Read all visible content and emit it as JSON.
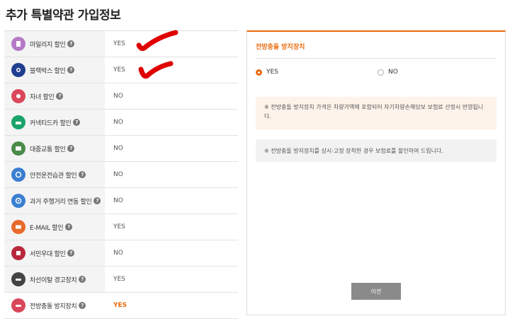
{
  "page_title": "추가 특별약관 가입정보",
  "items": [
    {
      "label": "마일리지 할인",
      "value": "YES",
      "icon": "mileage-icon",
      "color": "#b57ac6"
    },
    {
      "label": "블랙박스 할인",
      "value": "YES",
      "icon": "blackbox-icon",
      "color": "#1f3f8f"
    },
    {
      "label": "자녀 할인",
      "value": "NO",
      "icon": "child-icon",
      "color": "#d9485a"
    },
    {
      "label": "커넥티드카 할인",
      "value": "NO",
      "icon": "connected-car-icon",
      "color": "#1aa36a"
    },
    {
      "label": "대중교통 할인",
      "value": "NO",
      "icon": "bus-icon",
      "color": "#4a8c4a"
    },
    {
      "label": "안전운전습관 할인",
      "value": "NO",
      "icon": "safe-driving-icon",
      "color": "#3b7fd1"
    },
    {
      "label": "과거 주행거리 연동 할인",
      "value": "NO",
      "icon": "odometer-icon",
      "color": "#3b7fd1"
    },
    {
      "label": "E-MAIL 할인",
      "value": "YES",
      "icon": "email-icon",
      "color": "#e86a2c"
    },
    {
      "label": "서민우대 할인",
      "value": "NO",
      "icon": "low-income-icon",
      "color": "#b8283c"
    },
    {
      "label": "차선이탈 경고장치",
      "value": "YES",
      "icon": "lane-departure-icon",
      "color": "#444"
    },
    {
      "label": "전방충돌 방지장치",
      "value": "YES",
      "icon": "collision-icon",
      "color": "#d9485a"
    }
  ],
  "panel": {
    "title": "전방충돌 방지장치",
    "options": [
      "YES",
      "NO"
    ],
    "selected": "YES",
    "note1": "※ 전방충돌 방지장치 가격은 차량가액에 포함되어 자기차량손해담보 보험료 산정시 반영됩니다.",
    "note2": "※ 전방충돌 방지장치를 상시·고정 장착한 경우 보험료를 할인하여 드립니다.",
    "prev_label": "이전"
  },
  "colors": {
    "accent": "#e8690b",
    "row_bg": "#f4f4f4",
    "button": "#8a8a8a",
    "annotation": "#e00000"
  }
}
